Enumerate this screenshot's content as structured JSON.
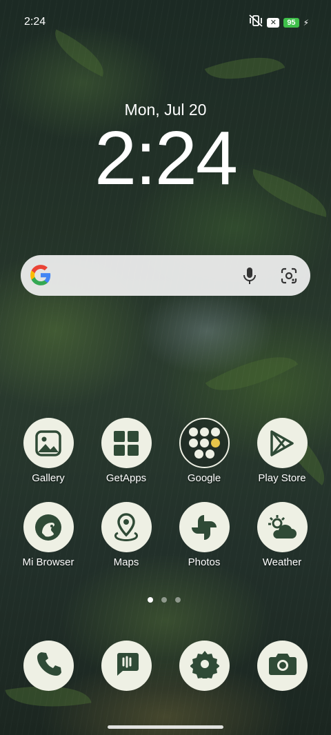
{
  "status_bar": {
    "time": "2:24",
    "battery": "95"
  },
  "lock": {
    "date": "Mon, Jul 20",
    "clock": "2:24"
  },
  "apps_row1": [
    {
      "label": "Gallery"
    },
    {
      "label": "GetApps"
    },
    {
      "label": "Google"
    },
    {
      "label": "Play Store"
    }
  ],
  "apps_row2": [
    {
      "label": "Mi Browser"
    },
    {
      "label": "Maps"
    },
    {
      "label": "Photos"
    },
    {
      "label": "Weather"
    }
  ],
  "colors": {
    "icon_bg": "#eef0e4",
    "icon_fg": "#2f4a36",
    "battery": "#3fbf4a"
  }
}
